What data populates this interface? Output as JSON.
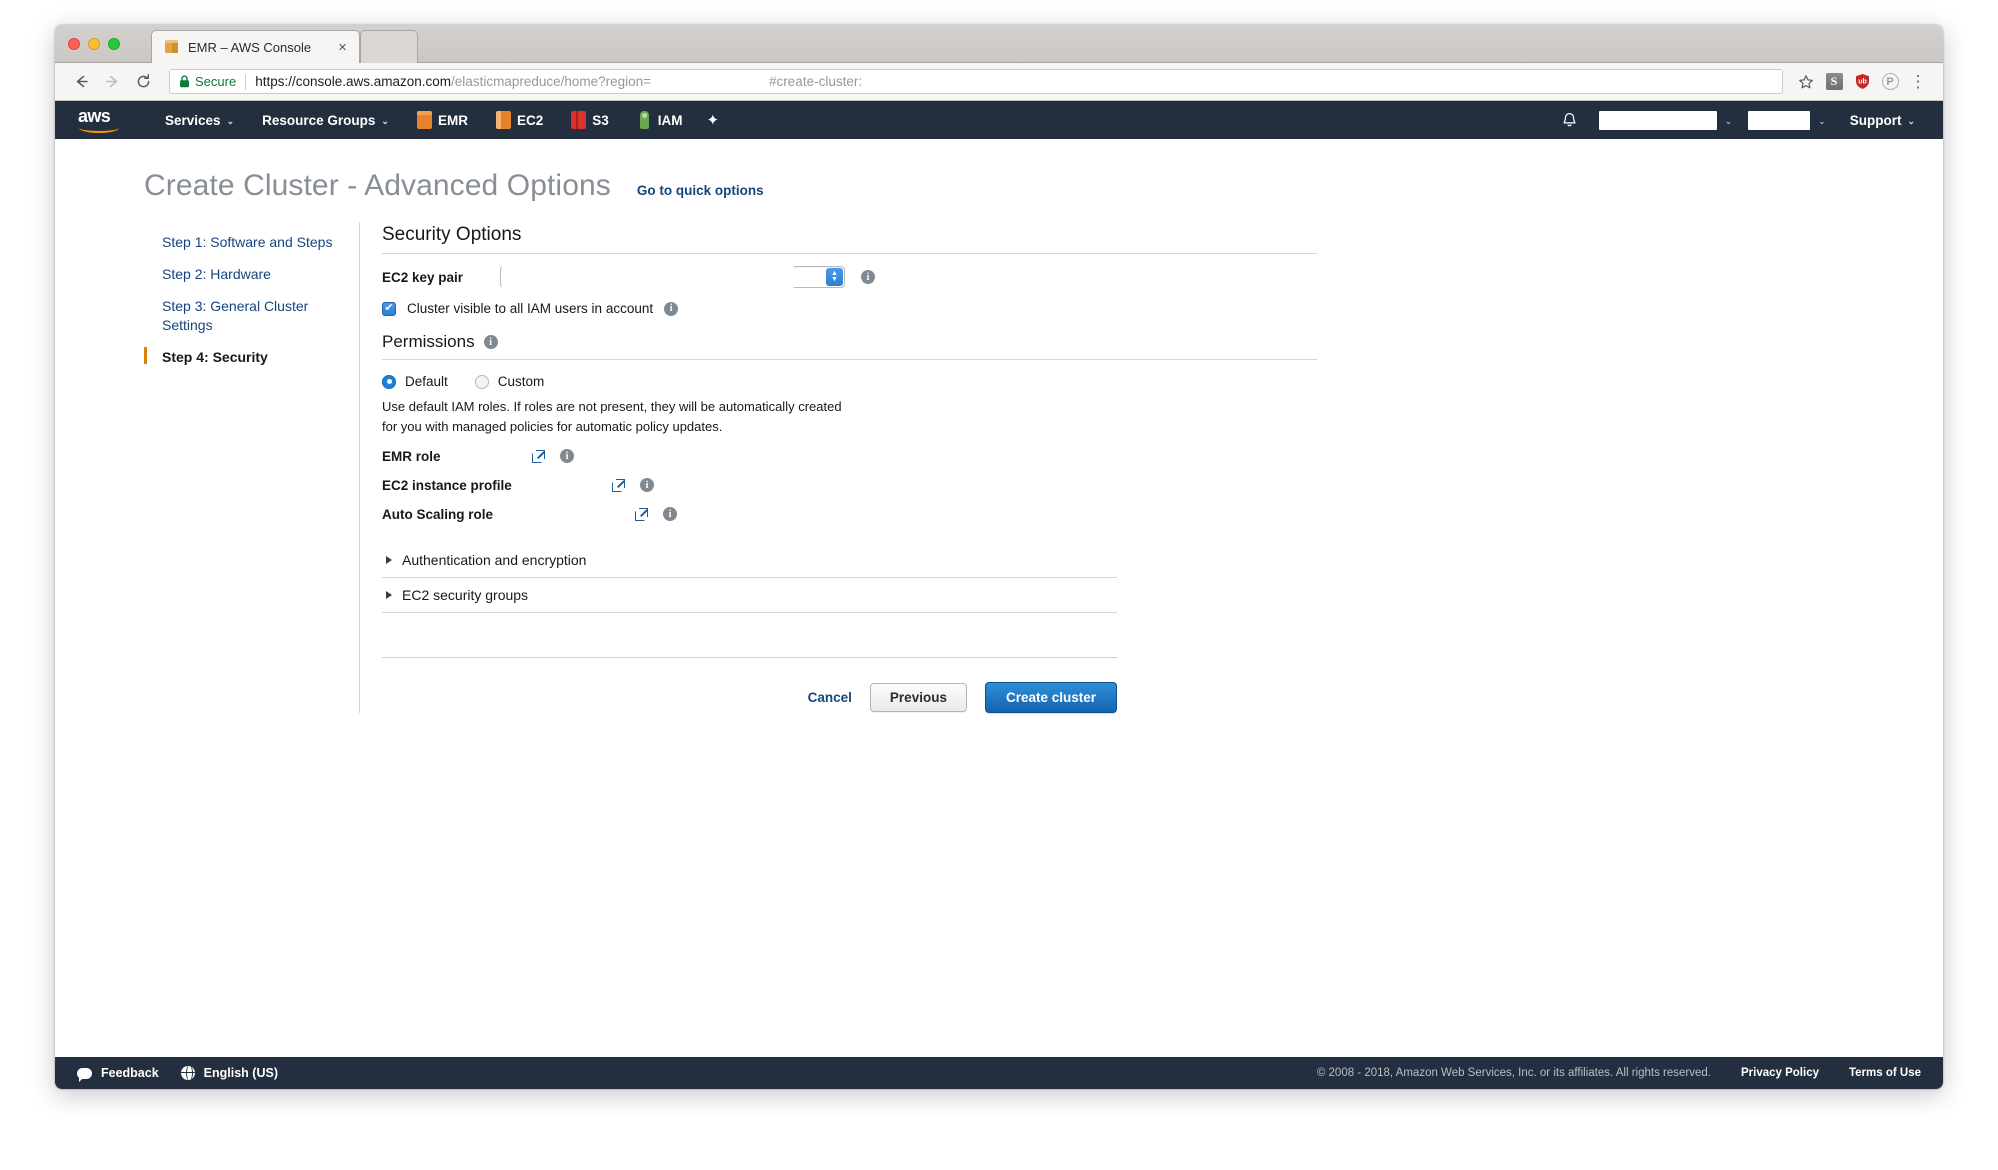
{
  "browser": {
    "tab": {
      "title": "EMR – AWS Console",
      "favicon": "cube-icon",
      "close": "×"
    },
    "omnibox": {
      "secure_label": "Secure",
      "url_host": "https://console.aws.amazon.com",
      "url_path": "/elasticmapreduce/home?region=",
      "url_fragment": "#create-cluster:"
    },
    "extensions": [
      "bookmark-star-icon",
      "S",
      "ublock-shield-icon",
      "P",
      "chrome-menu-icon"
    ]
  },
  "aws_nav": {
    "logo": "aws",
    "items": [
      {
        "label": "Services",
        "caret": "⌄"
      },
      {
        "label": "Resource Groups",
        "caret": "⌄"
      }
    ],
    "services": [
      {
        "label": "EMR",
        "icon": "emr-icon"
      },
      {
        "label": "EC2",
        "icon": "ec2-icon"
      },
      {
        "label": "S3",
        "icon": "s3-icon"
      },
      {
        "label": "IAM",
        "icon": "iam-icon"
      }
    ],
    "pin_icon": "✦",
    "bell_icon": "bell-icon",
    "account": "",
    "region": "",
    "support": {
      "label": "Support",
      "caret": "⌄"
    }
  },
  "header": {
    "title": "Create Cluster - Advanced Options",
    "quick_options_link": "Go to quick options"
  },
  "steps": [
    {
      "label": "Step 1: Software and Steps",
      "active": false
    },
    {
      "label": "Step 2: Hardware",
      "active": false
    },
    {
      "label": "Step 3: General Cluster Settings",
      "active": false
    },
    {
      "label": "Step 4: Security",
      "active": true
    }
  ],
  "security": {
    "section_title": "Security Options",
    "key_pair": {
      "label": "EC2 key pair",
      "value": "",
      "stepper_up": "▲",
      "stepper_down": "▼"
    },
    "visible_checkbox": {
      "label": "Cluster visible to all IAM users in account",
      "checked": true,
      "check_glyph": "✔"
    },
    "permissions": {
      "title": "Permissions",
      "options": [
        {
          "label": "Default",
          "selected": true
        },
        {
          "label": "Custom",
          "selected": false
        }
      ],
      "description": "Use default IAM roles. If roles are not present, they will be automatically created for you with managed policies for automatic policy updates."
    },
    "roles": [
      {
        "label": "EMR role",
        "value": "",
        "label_width": 150
      },
      {
        "label": "EC2 instance profile",
        "value": "",
        "label_width": 230
      },
      {
        "label": "Auto Scaling role",
        "value": "",
        "label_width": 253
      }
    ],
    "accordions": [
      {
        "label": "Authentication and encryption",
        "expanded": false
      },
      {
        "label": "EC2 security groups",
        "expanded": false
      }
    ],
    "buttons": {
      "cancel": "Cancel",
      "previous": "Previous",
      "create": "Create cluster"
    }
  },
  "footer": {
    "feedback": "Feedback",
    "language": "English (US)",
    "copyright": "© 2008 - 2018, Amazon Web Services, Inc. or its affiliates. All rights reserved.",
    "privacy": "Privacy Policy",
    "terms": "Terms of Use"
  },
  "colors": {
    "aws_navy": "#232f3e",
    "aws_orange": "#ff9900",
    "link_blue": "#16457e",
    "primary_button": "#1464ad",
    "active_step_marker": "#d9820a"
  }
}
